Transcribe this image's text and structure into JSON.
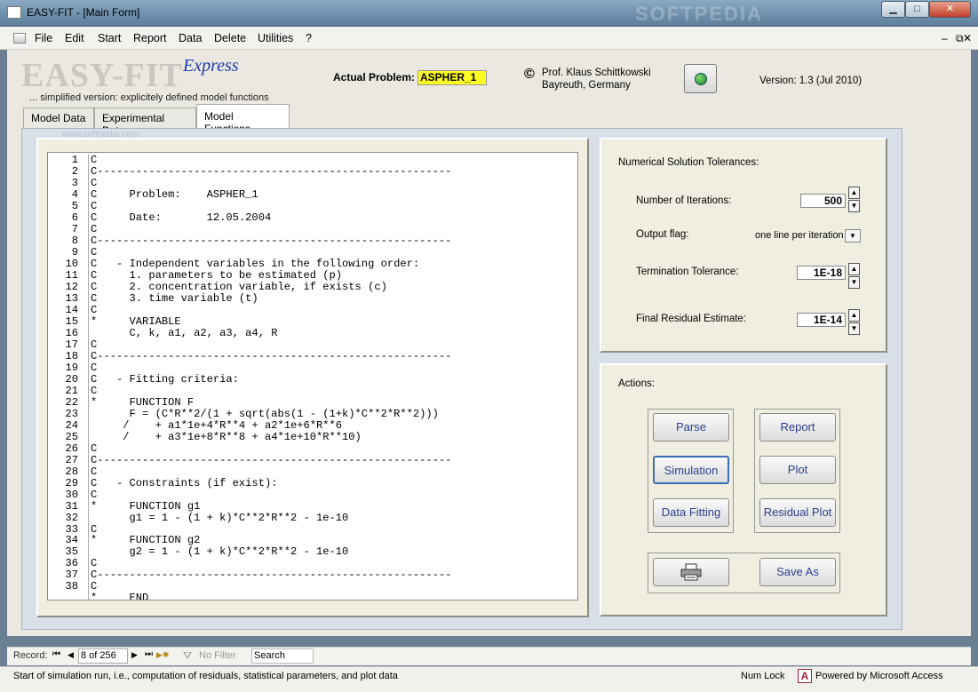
{
  "window": {
    "title": "EASY-FIT - [Main Form]",
    "minimize": "▁",
    "maximize": "□",
    "close": "✕",
    "watermark": "SOFTPEDIA"
  },
  "menu": {
    "items": [
      "File",
      "Edit",
      "Start",
      "Report",
      "Data",
      "Delete",
      "Utilities",
      "?"
    ],
    "mdi_controls": [
      "–",
      "⧉",
      "✕"
    ]
  },
  "header": {
    "logo": "EASY-FIT",
    "express": "Express",
    "subtitle": "... simplified version: explicitely defined model functions",
    "actual_problem_label": "Actual Problem:",
    "actual_problem_value": "ASPHER_1",
    "copyright_symbol": "©",
    "author_line1": "Prof. Klaus Schittkowski",
    "author_line2": "Bayreuth, Germany",
    "version": "Version:  1.3 (Jul 2010)"
  },
  "tabs": [
    {
      "label": "Model Data",
      "active": false
    },
    {
      "label": "Experimental Data",
      "active": false
    },
    {
      "label": "Model Functions",
      "active": true
    }
  ],
  "code": {
    "watermark": "www.softpedia.com",
    "line_numbers": "1\n2\n3\n4\n5\n6\n7\n8\n9\n10\n11\n12\n13\n14\n15\n16\n17\n18\n19\n20\n21\n22\n23\n24\n25\n26\n27\n28\n29\n30\n31\n32\n33\n34\n35\n36\n37\n38",
    "text": "C\nC-------------------------------------------------------\nC\nC     Problem:    ASPHER_1\nC\nC     Date:       12.05.2004\nC\nC-------------------------------------------------------\nC\nC   - Independent variables in the following order:\nC     1. parameters to be estimated (p)\nC     2. concentration variable, if exists (c)\nC     3. time variable (t)\nC\n*     VARIABLE\n      C, k, a1, a2, a3, a4, R\nC\nC-------------------------------------------------------\nC\nC   - Fitting criteria:\nC\n*     FUNCTION F\n      F = (C*R**2/(1 + sqrt(abs(1 - (1+k)*C**2*R**2)))\n     /    + a1*1e+4*R**4 + a2*1e+6*R**6\n     /    + a3*1e+8*R**8 + a4*1e+10*R**10)\nC\nC-------------------------------------------------------\nC\nC   - Constraints (if exist):\nC\n*     FUNCTION g1\n      g1 = 1 - (1 + k)*C**2*R**2 - 1e-10\nC\n*     FUNCTION g2\n      g2 = 1 - (1 + k)*C**2*R**2 - 1e-10\nC\nC-------------------------------------------------------\nC\n*     END"
  },
  "tolerances": {
    "heading": "Numerical Solution Tolerances:",
    "iterations_label": "Number of Iterations:",
    "iterations_value": "500",
    "output_flag_label": "Output flag:",
    "output_flag_value": "one line per iteration",
    "termination_label": "Termination Tolerance:",
    "termination_value": "1E-18",
    "residual_label": "Final Residual Estimate:",
    "residual_value": "1E-14"
  },
  "actions": {
    "heading": "Actions:",
    "parse": "Parse",
    "simulation": "Simulation",
    "data_fitting": "Data Fitting",
    "report": "Report",
    "plot": "Plot",
    "residual_plot": "Residual Plot",
    "save_as": "Save As"
  },
  "navigator": {
    "record_label": "Record:",
    "record_value": "8 of 256",
    "first": "⏮",
    "prev": "◀",
    "next": "▶",
    "last": "⏭",
    "new": "▶✱",
    "filter": "No Filter",
    "search_placeholder": "Search"
  },
  "status": {
    "message": "Start of simulation run, i.e., computation of residuals, statistical parameters, and plot data",
    "num_lock": "Num Lock",
    "access_logo": "A",
    "powered_by": "Powered by Microsoft Access"
  }
}
